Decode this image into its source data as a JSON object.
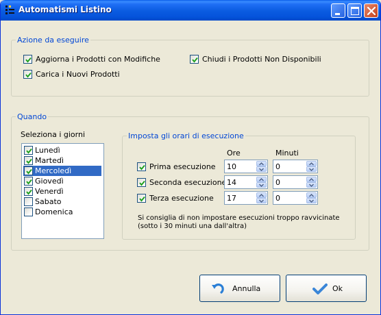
{
  "window": {
    "title": "Automatismi Listino"
  },
  "actions_group": {
    "legend": "Azione da eseguire",
    "items": [
      {
        "label": "Aggiorna i Prodotti con Modifiche",
        "checked": true
      },
      {
        "label": "Carica i Nuovi Prodotti",
        "checked": true
      },
      {
        "label": "Chiudi i Prodotti Non Disponibili",
        "checked": true
      }
    ]
  },
  "when_group": {
    "legend": "Quando",
    "days_label": "Seleziona  i giorni",
    "days": [
      {
        "label": "Lunedì",
        "checked": true
      },
      {
        "label": "Martedì",
        "checked": true
      },
      {
        "label": "Mercoledì",
        "checked": true,
        "selected": true
      },
      {
        "label": "Giovedì",
        "checked": true
      },
      {
        "label": "Venerdì",
        "checked": true
      },
      {
        "label": "Sabato",
        "checked": false
      },
      {
        "label": "Domenica",
        "checked": false
      }
    ],
    "schedule": {
      "legend": "Imposta gli orari di esecuzione",
      "col_hours": "Ore",
      "col_minutes": "Minuti",
      "rows": [
        {
          "label": "Prima esecuzione",
          "checked": true,
          "hours": "10",
          "minutes": "0"
        },
        {
          "label": "Seconda esecuzione",
          "checked": true,
          "hours": "14",
          "minutes": "0"
        },
        {
          "label": "Terza esecuzione",
          "checked": true,
          "hours": "17",
          "minutes": "0"
        }
      ],
      "note": "Si consiglia di non impostare esecuzioni troppo ravvicinate",
      "note2": "(sotto i 30 minuti una dall'altra)"
    }
  },
  "buttons": {
    "cancel": "Annulla",
    "ok": "Ok"
  },
  "colors": {
    "title_bar": "#0054e3",
    "group_legend": "#0046d5",
    "selection": "#316ac5"
  }
}
